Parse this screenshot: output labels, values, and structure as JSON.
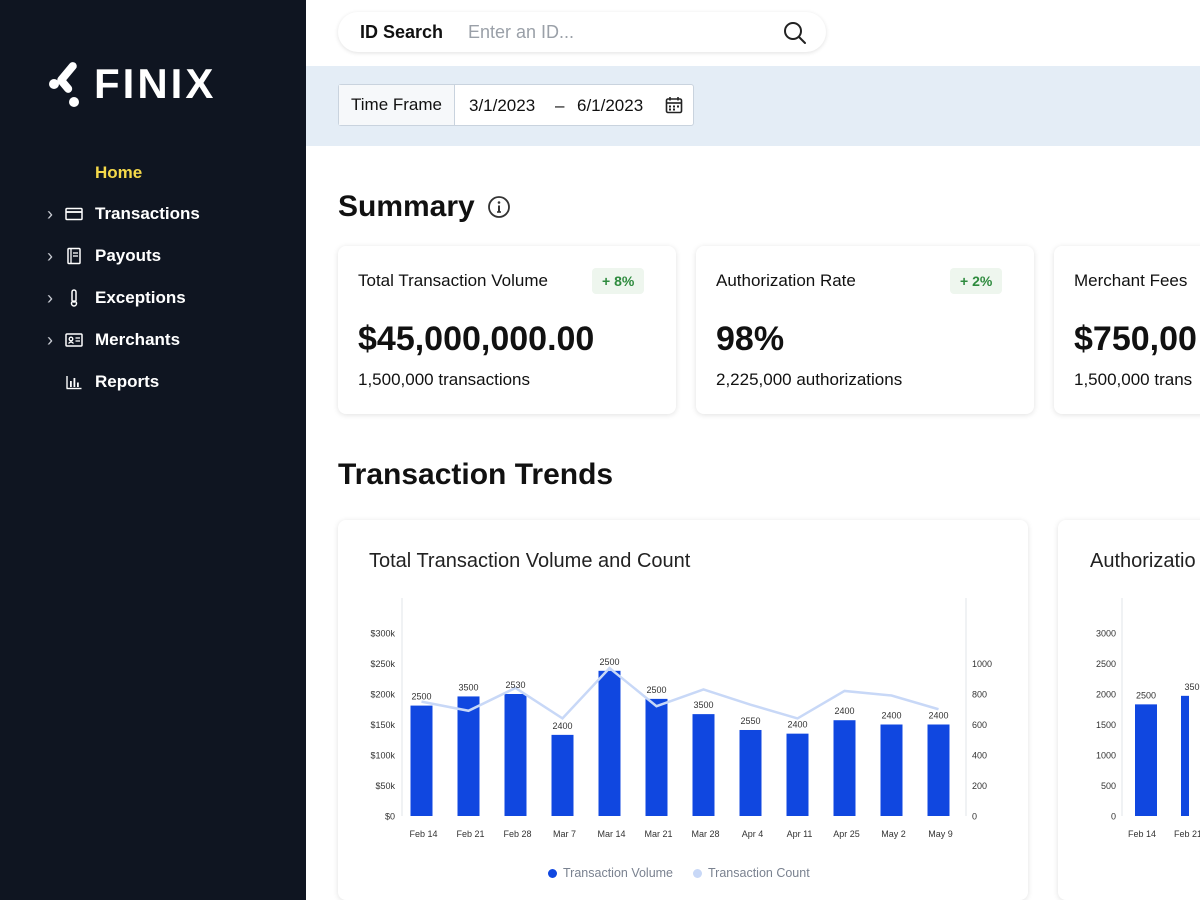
{
  "brand": {
    "name": "FINIX"
  },
  "nav": [
    {
      "label": "Home",
      "icon": "",
      "chevron": false,
      "active": true
    },
    {
      "label": "Transactions",
      "icon": "credit-card-icon",
      "chevron": true,
      "active": false
    },
    {
      "label": "Payouts",
      "icon": "ledger-icon",
      "chevron": true,
      "active": false
    },
    {
      "label": "Exceptions",
      "icon": "thermometer-icon",
      "chevron": true,
      "active": false
    },
    {
      "label": "Merchants",
      "icon": "id-card-icon",
      "chevron": true,
      "active": false
    },
    {
      "label": "Reports",
      "icon": "bar-chart-icon",
      "chevron": false,
      "active": false
    }
  ],
  "search": {
    "label": "ID Search",
    "placeholder": "Enter an ID..."
  },
  "timeframe": {
    "label": "Time Frame",
    "from": "3/1/2023",
    "separator": "–",
    "to": "6/1/2023"
  },
  "summary": {
    "title": "Summary",
    "cards": [
      {
        "title": "Total Transaction Volume",
        "badge": "+ 8%",
        "value": "$45,000,000.00",
        "sub": "1,500,000 transactions"
      },
      {
        "title": "Authorization Rate",
        "badge": "+ 2%",
        "value": "98%",
        "sub": "2,225,000 authorizations"
      },
      {
        "title": "Merchant Fees",
        "badge": "",
        "value": "$750,00",
        "sub": "1,500,000 trans"
      }
    ]
  },
  "trends": {
    "title": "Transaction Trends",
    "legend": {
      "volume": "Transaction Volume",
      "count": "Transaction Count"
    }
  },
  "colors": {
    "bar": "#1047e0",
    "line": "#c8d8f7",
    "accent": "#f5d94a",
    "sidebar": "#0f1521"
  },
  "chart_data": [
    {
      "type": "bar",
      "title": "Total Transaction Volume and Count",
      "categories": [
        "Feb 14",
        "Feb 21",
        "Feb 28",
        "Mar 7",
        "Mar 14",
        "Mar 21",
        "Mar 28",
        "Apr 4",
        "Apr 11",
        "Apr 25",
        "May 2",
        "May 9"
      ],
      "y_ticks": [
        "$0",
        "$50k",
        "$100k",
        "$150k",
        "$200k",
        "$250k",
        "$300k"
      ],
      "y2_ticks": [
        "0",
        "200",
        "400",
        "600",
        "800",
        "1000"
      ],
      "ylim": [
        0,
        300000
      ],
      "y2lim": [
        0,
        1200
      ],
      "series": [
        {
          "name": "Transaction Volume",
          "type": "bar",
          "axis": "left",
          "values": [
            181000,
            196000,
            200000,
            133000,
            238000,
            192000,
            167000,
            141000,
            135000,
            157000,
            150000,
            150000
          ],
          "labels": [
            "2500",
            "3500",
            "2530",
            "2400",
            "2500",
            "2500",
            "3500",
            "2550",
            "2400",
            "2400",
            "2400",
            "2400"
          ]
        },
        {
          "name": "Transaction Count",
          "type": "line",
          "axis": "right",
          "values": [
            750,
            690,
            840,
            640,
            970,
            720,
            830,
            730,
            640,
            820,
            790,
            700
          ]
        }
      ]
    },
    {
      "type": "bar",
      "title": "Authorizatio",
      "categories": [
        "Feb 14",
        "Feb 21"
      ],
      "y_ticks": [
        "0",
        "500",
        "1000",
        "1500",
        "2000",
        "2500",
        "3000"
      ],
      "ylim": [
        0,
        3000
      ],
      "series": [
        {
          "name": "Authorizations",
          "type": "bar",
          "values": [
            1830,
            1970
          ],
          "labels": [
            "2500",
            "350"
          ]
        }
      ]
    }
  ]
}
